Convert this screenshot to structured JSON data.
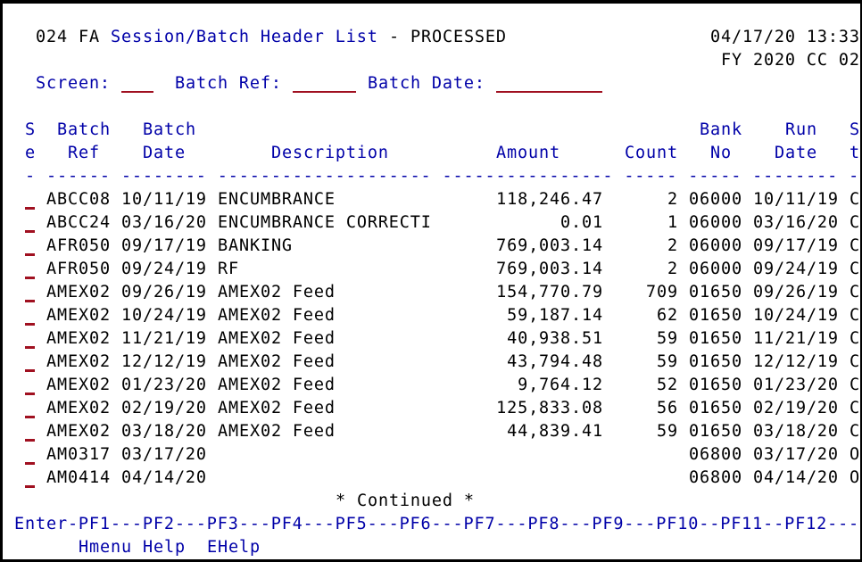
{
  "header": {
    "screen_code": "024 FA",
    "title": "Session/Batch Header List",
    "separator": "-",
    "status": "PROCESSED",
    "datetime": "04/17/20 13:33",
    "fy_cc": "FY 2020 CC 02"
  },
  "filters": {
    "screen_label": "Screen:",
    "screen_value": "",
    "batch_ref_label": "Batch Ref:",
    "batch_ref_value": "",
    "batch_date_label": "Batch Date:",
    "batch_date_value": ""
  },
  "columns": {
    "sel_1": "S",
    "sel_2": "e",
    "batch_ref_1": "Batch",
    "batch_ref_2": "Ref",
    "batch_date_1": "Batch",
    "batch_date_2": "Date",
    "description": "Description",
    "amount": "Amount",
    "count": "Count",
    "bank_no_1": "Bank",
    "bank_no_2": "No",
    "run_date_1": "Run",
    "run_date_2": "Date",
    "status_1": "S",
    "status_2": "t",
    "underline": "- ------ -------- -------------------- ---------------- ----- ----- -------- -"
  },
  "rows": [
    {
      "ref": "ABCC08",
      "date": "10/11/19",
      "desc": "ENCUMBRANCE",
      "amount": "118,246.47",
      "count": "2",
      "bank": "06000",
      "run": "10/11/19",
      "st": "C"
    },
    {
      "ref": "ABCC24",
      "date": "03/16/20",
      "desc": "ENCUMBRANCE CORRECTI",
      "amount": "0.01",
      "count": "1",
      "bank": "06000",
      "run": "03/16/20",
      "st": "C"
    },
    {
      "ref": "AFR050",
      "date": "09/17/19",
      "desc": "BANKING",
      "amount": "769,003.14",
      "count": "2",
      "bank": "06000",
      "run": "09/17/19",
      "st": "C"
    },
    {
      "ref": "AFR050",
      "date": "09/24/19",
      "desc": "RF",
      "amount": "769,003.14",
      "count": "2",
      "bank": "06000",
      "run": "09/24/19",
      "st": "C"
    },
    {
      "ref": "AMEX02",
      "date": "09/26/19",
      "desc": "AMEX02 Feed",
      "amount": "154,770.79",
      "count": "709",
      "bank": "01650",
      "run": "09/26/19",
      "st": "C"
    },
    {
      "ref": "AMEX02",
      "date": "10/24/19",
      "desc": "AMEX02 Feed",
      "amount": "59,187.14",
      "count": "62",
      "bank": "01650",
      "run": "10/24/19",
      "st": "C"
    },
    {
      "ref": "AMEX02",
      "date": "11/21/19",
      "desc": "AMEX02 Feed",
      "amount": "40,938.51",
      "count": "59",
      "bank": "01650",
      "run": "11/21/19",
      "st": "C"
    },
    {
      "ref": "AMEX02",
      "date": "12/12/19",
      "desc": "AMEX02 Feed",
      "amount": "43,794.48",
      "count": "59",
      "bank": "01650",
      "run": "12/12/19",
      "st": "C"
    },
    {
      "ref": "AMEX02",
      "date": "01/23/20",
      "desc": "AMEX02 Feed",
      "amount": "9,764.12",
      "count": "52",
      "bank": "01650",
      "run": "01/23/20",
      "st": "C"
    },
    {
      "ref": "AMEX02",
      "date": "02/19/20",
      "desc": "AMEX02 Feed",
      "amount": "125,833.08",
      "count": "56",
      "bank": "01650",
      "run": "02/19/20",
      "st": "C"
    },
    {
      "ref": "AMEX02",
      "date": "03/18/20",
      "desc": "AMEX02 Feed",
      "amount": "44,839.41",
      "count": "59",
      "bank": "01650",
      "run": "03/18/20",
      "st": "C"
    },
    {
      "ref": "AM0317",
      "date": "03/17/20",
      "desc": "",
      "amount": "",
      "count": "",
      "bank": "06800",
      "run": "03/17/20",
      "st": "O"
    },
    {
      "ref": "AM0414",
      "date": "04/14/20",
      "desc": "",
      "amount": "",
      "count": "",
      "bank": "06800",
      "run": "04/14/20",
      "st": "O"
    }
  ],
  "continued": "* Continued *",
  "pf_keys": "Enter-PF1---PF2---PF3---PF4---PF5---PF6---PF7---PF8---PF9---PF10--PF11--PF12---",
  "pf_labels": {
    "pf1": "Hmenu",
    "pf2": "Help",
    "pf3": "EHelp"
  }
}
